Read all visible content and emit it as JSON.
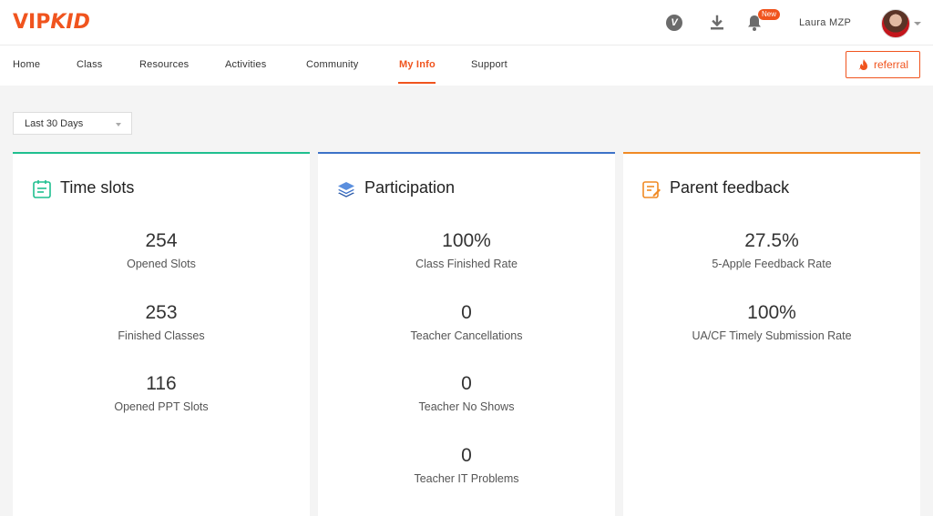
{
  "brand": {
    "logo_prefix": "VIP",
    "logo_suffix": "KID"
  },
  "header": {
    "new_badge": "New",
    "user_name": "Laura MZP"
  },
  "nav": {
    "items": [
      {
        "label": "Home"
      },
      {
        "label": "Class"
      },
      {
        "label": "Resources"
      },
      {
        "label": "Activities"
      },
      {
        "label": "Community"
      },
      {
        "label": "My Info"
      },
      {
        "label": "Support"
      }
    ],
    "active": "My Info",
    "referral_label": "referral"
  },
  "filter": {
    "selected": "Last 30 Days"
  },
  "colors": {
    "accent": "#f0541e",
    "time_slots": "#1fbf8f",
    "participation": "#3d72c8",
    "parent_feedback": "#f08a24"
  },
  "cards": [
    {
      "title": "Time slots",
      "icon": "calendar-icon",
      "stats": [
        {
          "value": "254",
          "label": "Opened Slots"
        },
        {
          "value": "253",
          "label": "Finished Classes"
        },
        {
          "value": "116",
          "label": "Opened PPT Slots"
        }
      ]
    },
    {
      "title": "Participation",
      "icon": "layers-icon",
      "stats": [
        {
          "value": "100%",
          "label": "Class Finished Rate"
        },
        {
          "value": "0",
          "label": "Teacher Cancellations"
        },
        {
          "value": "0",
          "label": "Teacher No Shows"
        },
        {
          "value": "0",
          "label": "Teacher IT Problems"
        }
      ]
    },
    {
      "title": "Parent feedback",
      "icon": "feedback-icon",
      "stats": [
        {
          "value": "27.5%",
          "label": "5-Apple Feedback Rate"
        },
        {
          "value": "100%",
          "label": "UA/CF Timely Submission Rate"
        }
      ]
    }
  ]
}
